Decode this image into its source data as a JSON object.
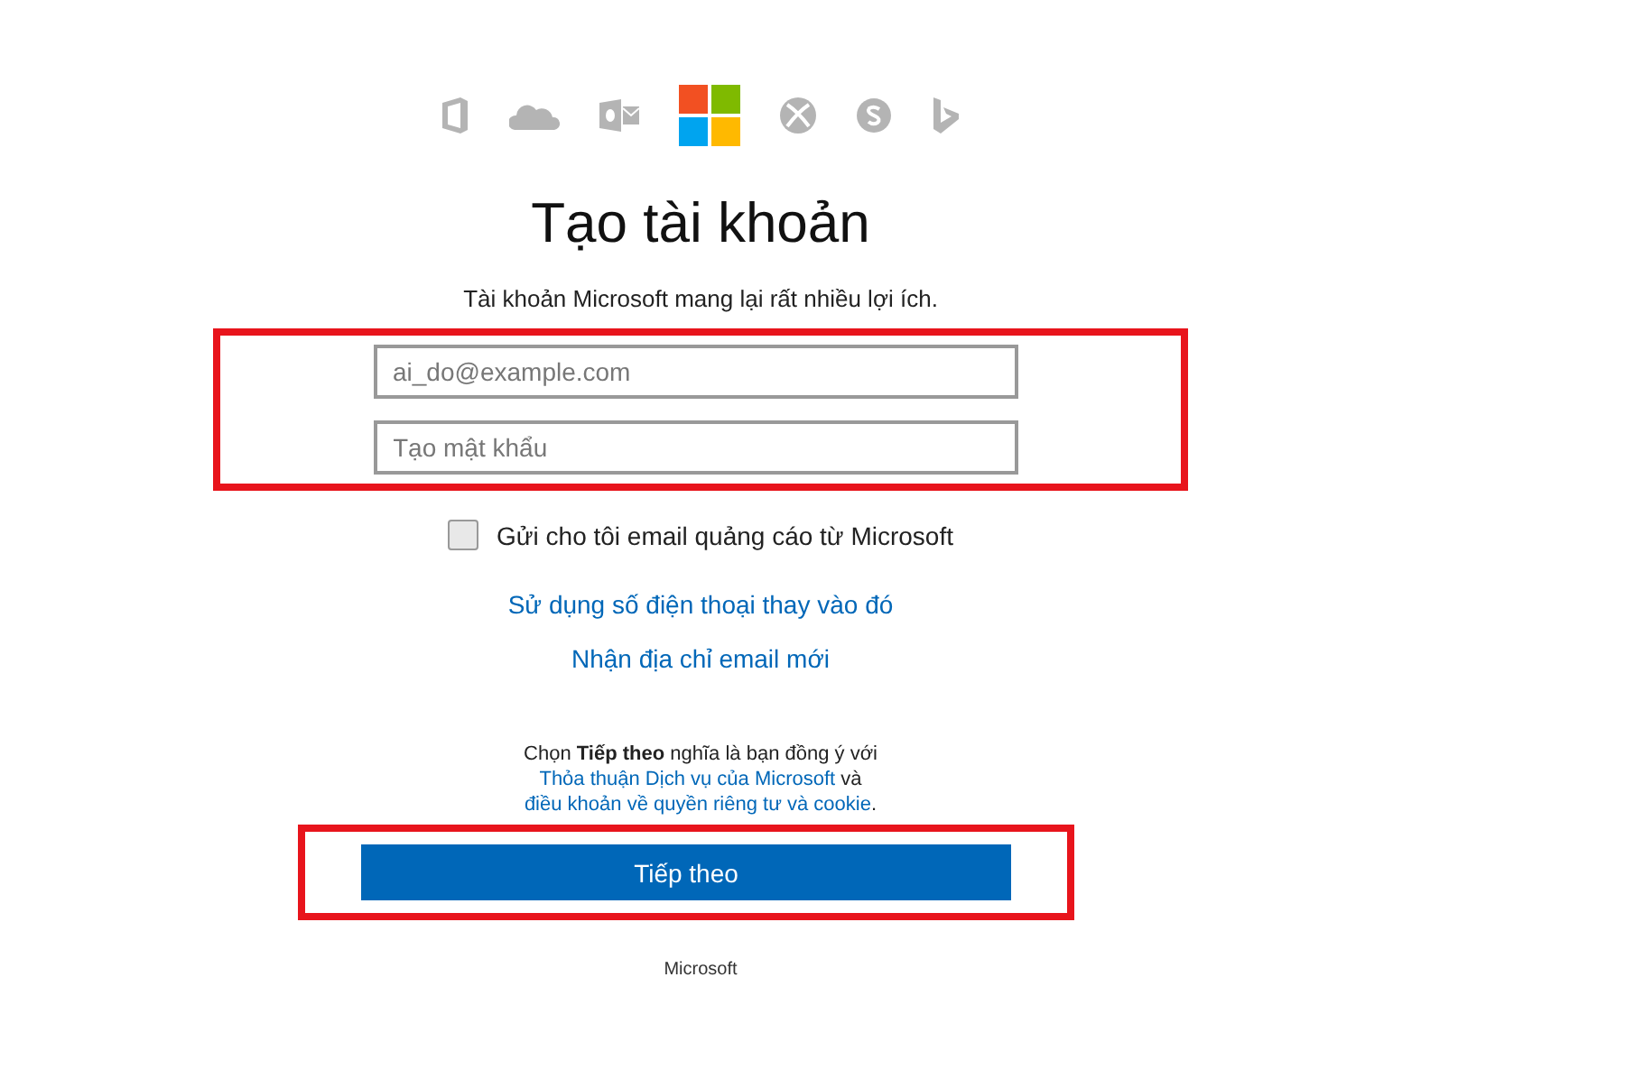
{
  "brand_icons": [
    {
      "kind": "office"
    },
    {
      "kind": "cloud"
    },
    {
      "kind": "outlook"
    },
    {
      "kind": "windows"
    },
    {
      "kind": "xbox"
    },
    {
      "kind": "skype"
    },
    {
      "kind": "bing"
    }
  ],
  "title": "Tạo tài khoản",
  "subtitle": "Tài khoản Microsoft mang lại rất nhiều lợi ích.",
  "fields": [
    {
      "placeholder": "ai_do@example.com"
    },
    {
      "placeholder": "Tạo mật khẩu"
    }
  ],
  "marketing_checkbox": {
    "label": "Gửi cho tôi email quảng cáo từ Microsoft",
    "checked": false
  },
  "links": [
    "Sử dụng số điện thoại thay vào đó",
    "Nhận địa chỉ email mới"
  ],
  "terms": {
    "before": "Chọn **Tiếp theo** nghĩa là bạn đồng ý với ",
    "link_1": "Thỏa thuận Dịch vụ của Microsoft",
    "middle": " và ",
    "link_2": "điều khoản về quyền riêng tư và cookie",
    "after": "."
  },
  "next_button": "Tiếp theo",
  "footer": "Microsoft"
}
